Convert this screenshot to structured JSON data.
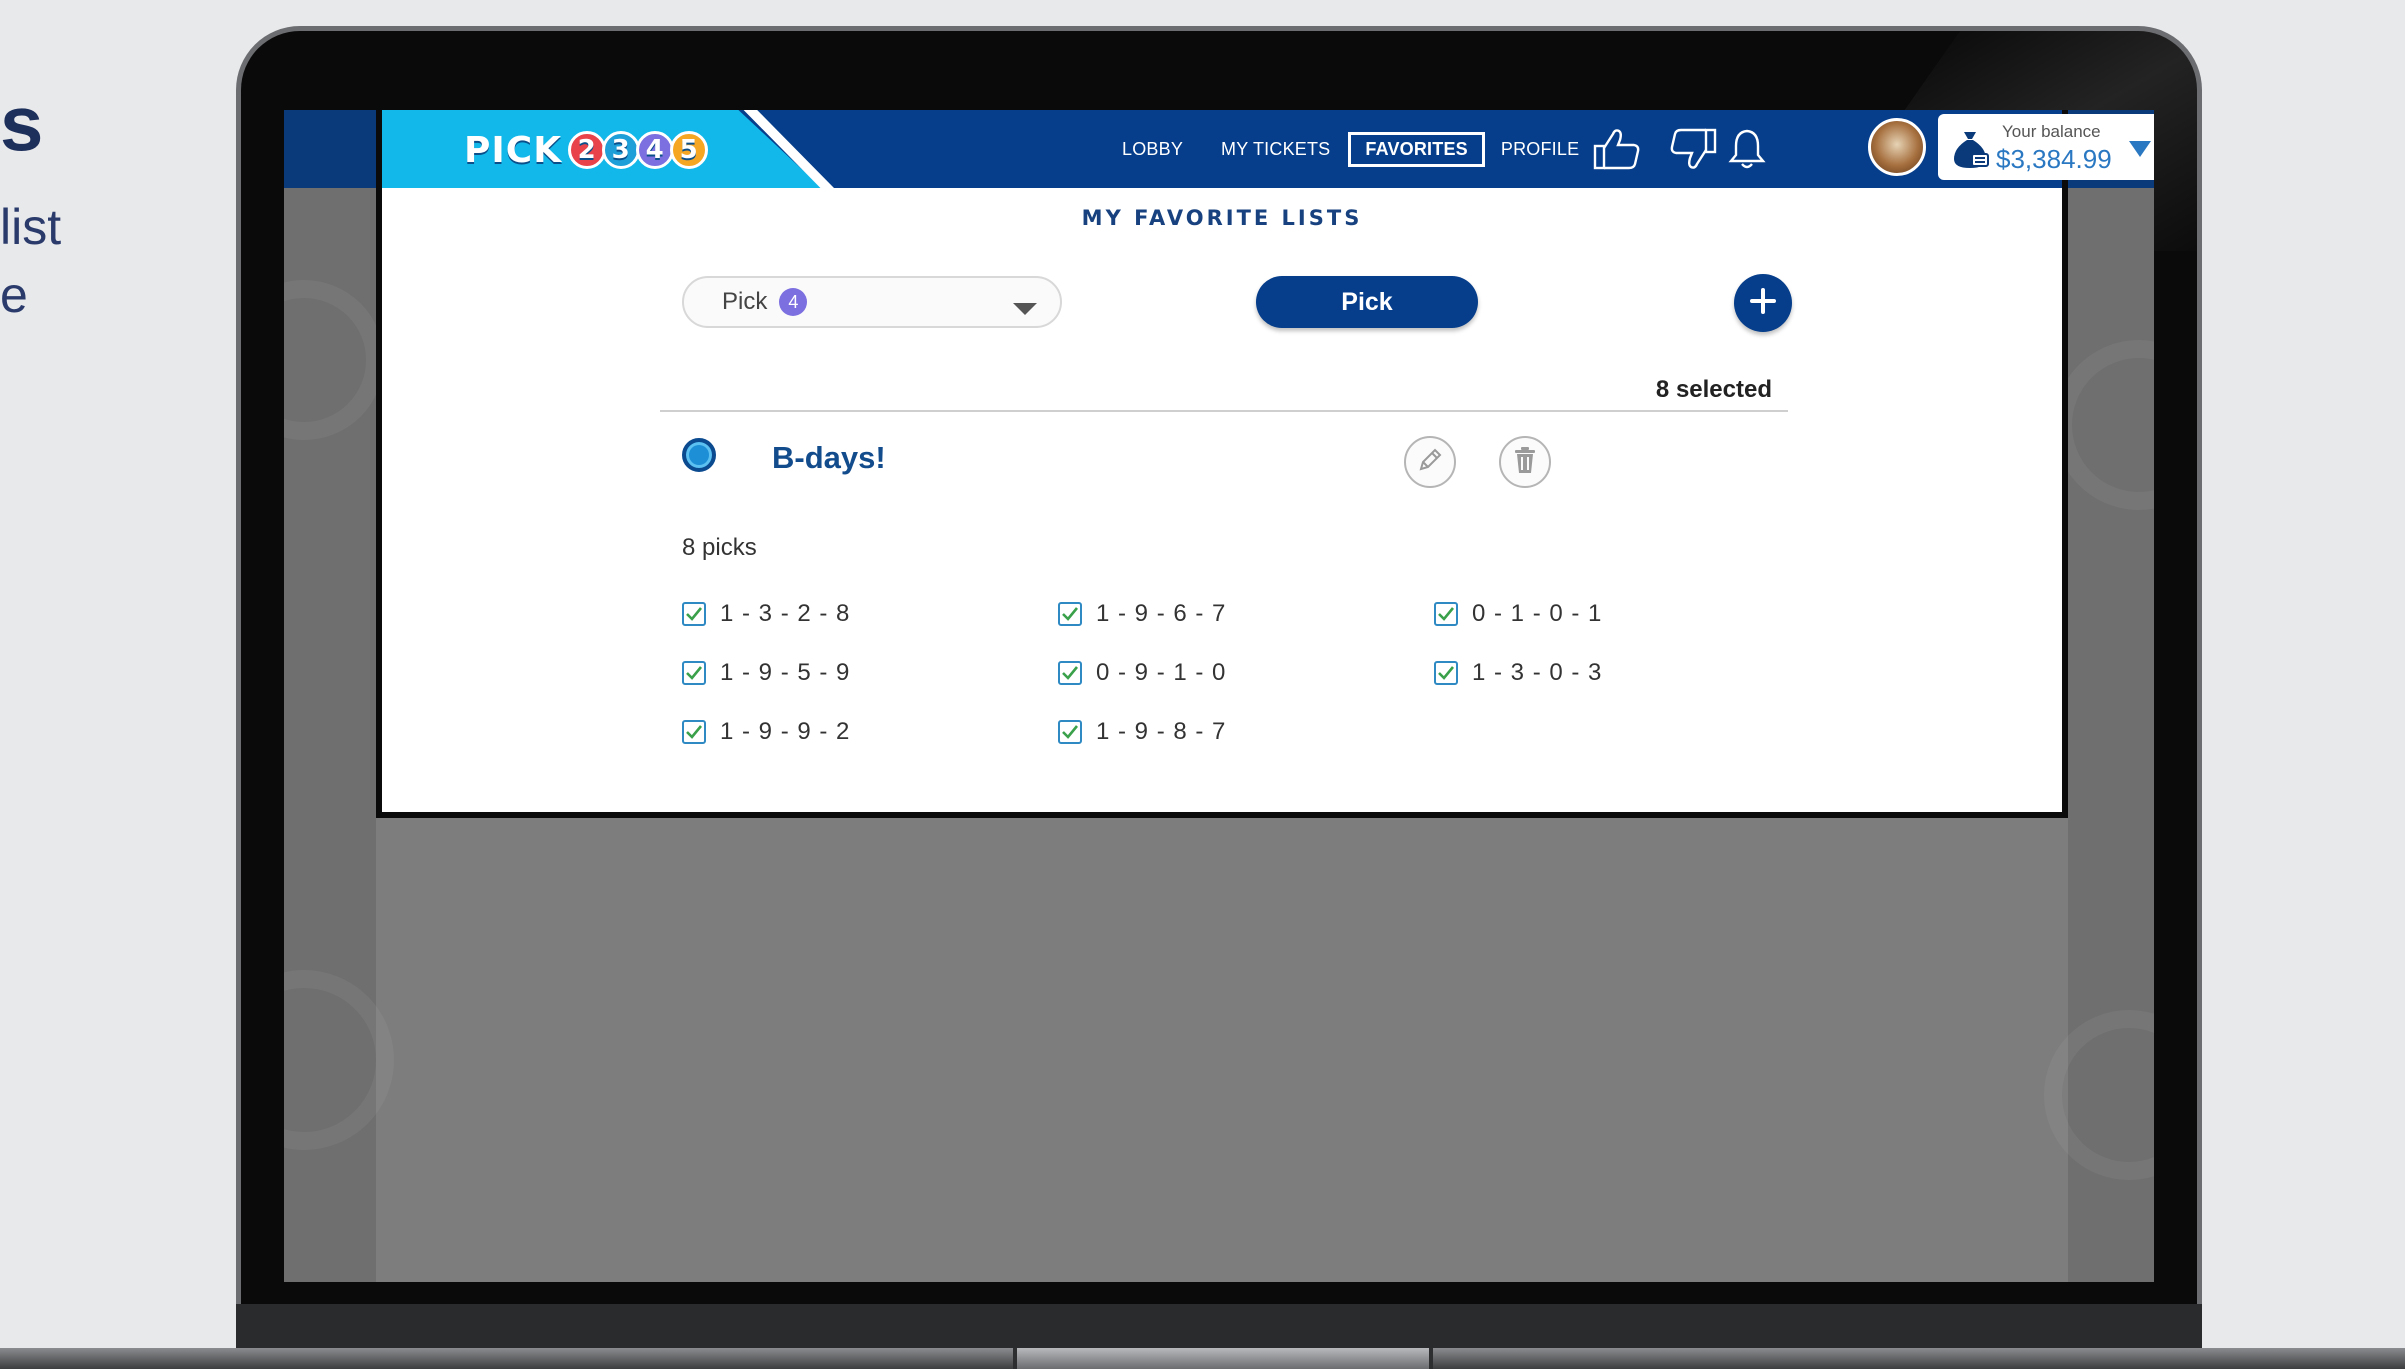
{
  "slide": {
    "heading_fragment": "s",
    "line1_fragment": "list",
    "line2_fragment": "e"
  },
  "header": {
    "logo_text": "PICK",
    "logo_balls": [
      "2",
      "3",
      "4",
      "5"
    ],
    "nav": {
      "lobby": "LOBBY",
      "my_tickets": "MY TICKETS",
      "favorites": "FAVORITES",
      "profile": "PROFILE"
    },
    "balance_label": "Your balance",
    "balance_value": "$3,384.99"
  },
  "page": {
    "title": "MY FAVORITE LISTS",
    "game_select": {
      "value": "Pick",
      "badge": "4"
    },
    "pick_button": "Pick",
    "selected_count": "8 selected"
  },
  "list": {
    "name": "B-days!",
    "picks_count": "8 picks",
    "picks": [
      {
        "value": "1 - 3 - 2 - 8",
        "checked": true
      },
      {
        "value": "1 - 9 - 6 - 7",
        "checked": true
      },
      {
        "value": "0 - 1 - 0 - 1",
        "checked": true
      },
      {
        "value": "1 - 9 - 5 - 9",
        "checked": true
      },
      {
        "value": "0 - 9 - 1 - 0",
        "checked": true
      },
      {
        "value": "1 - 3 - 0 - 3",
        "checked": true
      },
      {
        "value": "1 - 9 - 9 - 2",
        "checked": true
      },
      {
        "value": "1 - 9 - 8 - 7",
        "checked": true
      }
    ]
  },
  "colors": {
    "header_blue": "#063e8b",
    "logo_cyan": "#13b8ea",
    "accent_blue": "#2b78c2",
    "badge_purple": "#7c6fe0",
    "checkbox_blue": "#2f8ac4"
  },
  "icons": {
    "thumbs_up": "thumbs-up-icon",
    "thumbs_down": "thumbs-down-icon",
    "bell": "bell-icon",
    "money_bag": "money-bag-icon",
    "caret": "caret-down-icon",
    "plus": "plus-icon",
    "edit": "pencil-icon",
    "delete": "trash-icon",
    "check": "check-icon"
  }
}
